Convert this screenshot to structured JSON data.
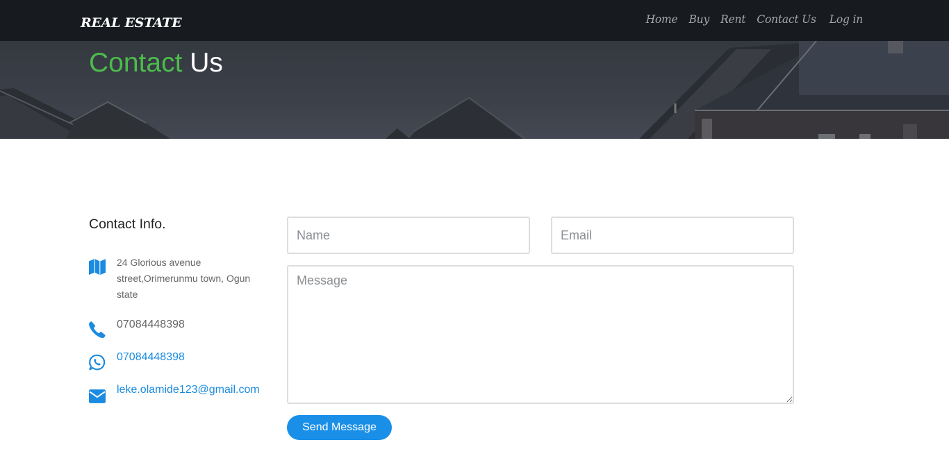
{
  "navbar": {
    "brand": "REAL ESTATE",
    "links": [
      {
        "label": "Home"
      },
      {
        "label": "Buy"
      },
      {
        "label": "Rent"
      },
      {
        "label": "Contact Us"
      },
      {
        "label": "Log in"
      }
    ]
  },
  "hero": {
    "title_accent": "Contact",
    "title_rest": "Us"
  },
  "contact_info": {
    "title": "Contact Info.",
    "address": "24 Glorious avenue street,Orimerunmu town, Ogun state",
    "phone": "07084448398",
    "whatsapp": "07084448398",
    "email": "leke.olamide123@gmail.com",
    "icons": {
      "address": "map-icon",
      "phone": "phone-icon",
      "whatsapp": "whatsapp-icon",
      "email": "envelope-icon"
    }
  },
  "form": {
    "name_placeholder": "Name",
    "email_placeholder": "Email",
    "message_placeholder": "Message",
    "submit_label": "Send Message"
  },
  "colors": {
    "navbar": "#171b1f",
    "accent_green": "#4cbb4c",
    "link_blue": "#1a8be0",
    "button_blue": "#1a8fe8"
  }
}
